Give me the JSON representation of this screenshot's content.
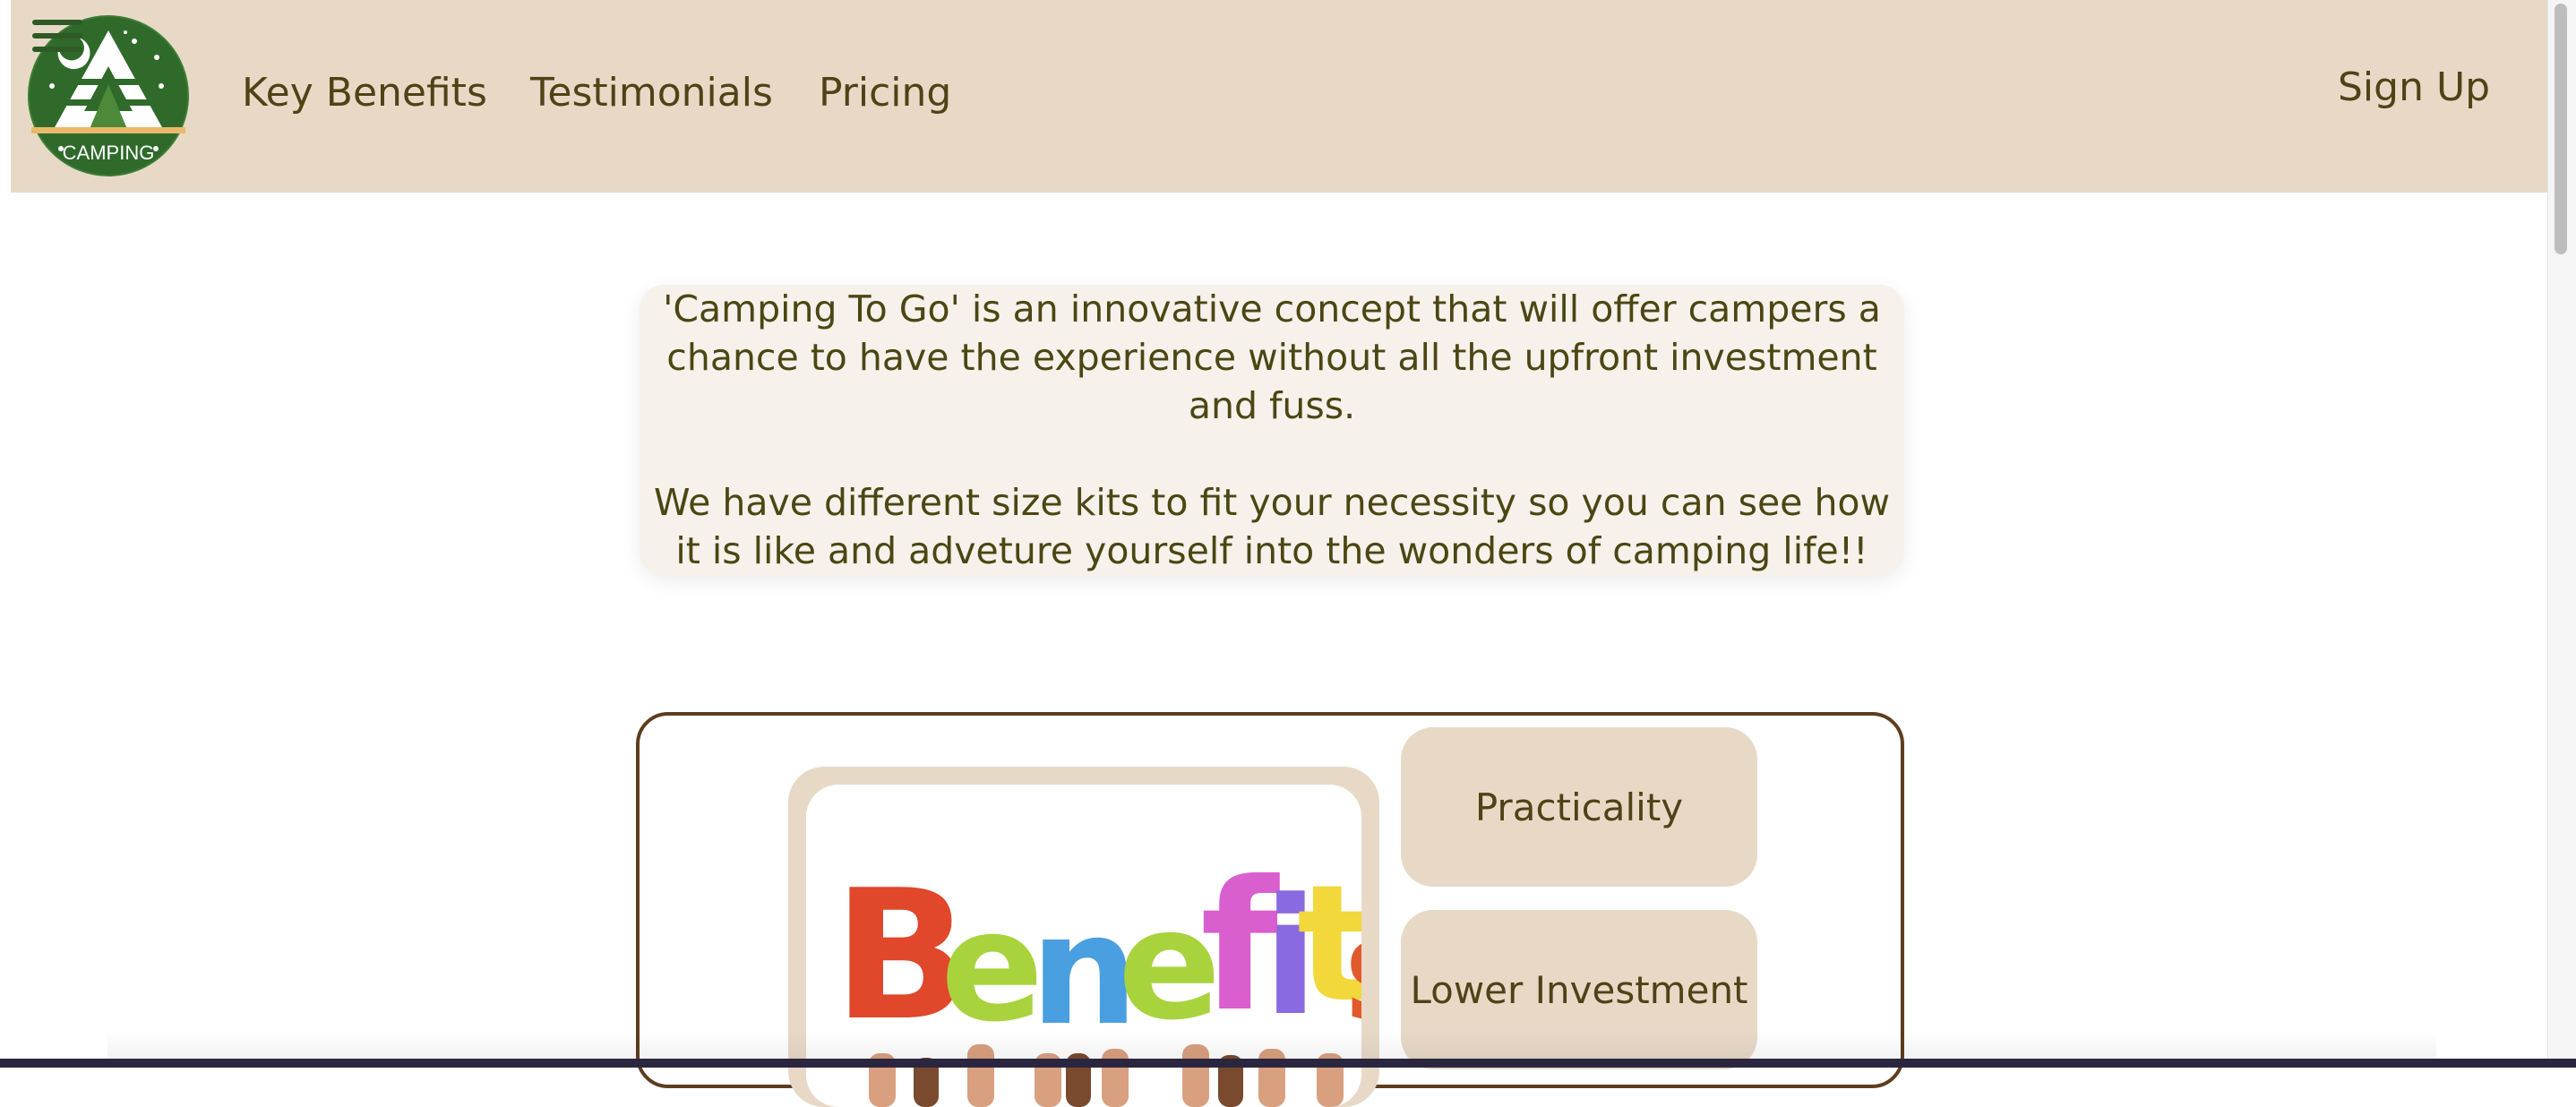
{
  "header": {
    "logo_text": "CAMPING",
    "nav": [
      "Key Benefits",
      "Testimonials",
      "Pricing"
    ],
    "sign_up": "Sign Up"
  },
  "intro": {
    "paragraph1": "'Camping To Go' is an innovative concept that will offer campers a chance to have the experience without all the upfront investment and fuss.",
    "paragraph2": "We have different size kits to fit your necessity so you can see how it is like and adveture yourself into the wonders of camping life!!"
  },
  "benefits": {
    "image_word": "Benefits",
    "items": [
      "Practicality",
      "Lower Investment"
    ]
  },
  "colors": {
    "header_bg": "#e8d9c7",
    "text": "#4d4416",
    "logo_green": "#2d6b2b",
    "border_brown": "#5c3e1e"
  }
}
